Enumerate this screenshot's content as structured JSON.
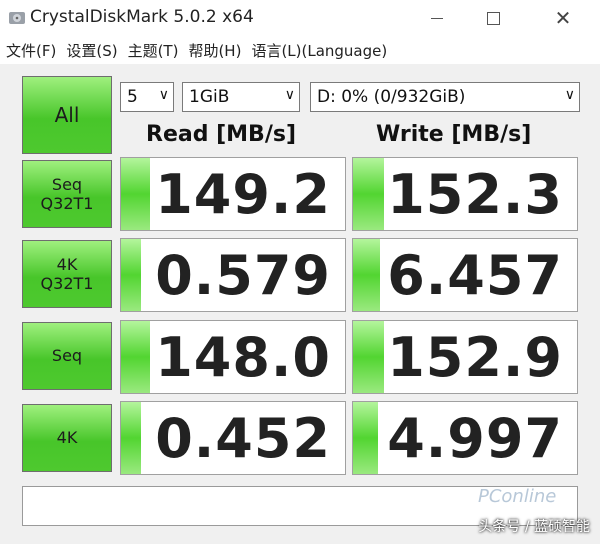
{
  "window": {
    "title": "CrystalDiskMark 5.0.2 x64",
    "icon": "app-icon"
  },
  "menu": [
    {
      "label": "文件(F)"
    },
    {
      "label": "设置(S)"
    },
    {
      "label": "主题(T)"
    },
    {
      "label": "帮助(H)"
    },
    {
      "label": "语言(L)(Language)"
    }
  ],
  "controls": {
    "all_label": "All",
    "count": "5",
    "size": "1GiB",
    "drive": "D: 0% (0/932GiB)"
  },
  "headers": {
    "read": "Read [MB/s]",
    "write": "Write [MB/s]"
  },
  "rows": [
    {
      "label_line1": "Seq",
      "label_line2": "Q32T1",
      "read": "149.2",
      "write": "152.3",
      "read_fill": 0.13,
      "write_fill": 0.14
    },
    {
      "label_line1": "4K",
      "label_line2": "Q32T1",
      "read": "0.579",
      "write": "6.457",
      "read_fill": 0.09,
      "write_fill": 0.12
    },
    {
      "label_line1": "Seq",
      "label_line2": "",
      "read": "148.0",
      "write": "152.9",
      "read_fill": 0.13,
      "write_fill": 0.14
    },
    {
      "label_line1": "4K",
      "label_line2": "",
      "read": "0.452",
      "write": "4.997",
      "read_fill": 0.09,
      "write_fill": 0.11
    }
  ],
  "comment": "",
  "watermarks": {
    "site": "PConline",
    "author": "头条号 / 蓝硕智能"
  },
  "colors": {
    "accent_green": "#48c62a",
    "fill_green": "#52d531"
  }
}
